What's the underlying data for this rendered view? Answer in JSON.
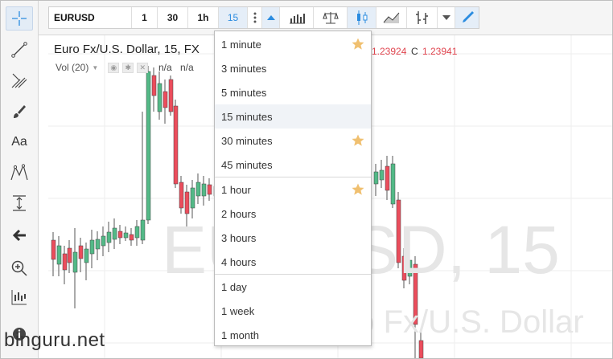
{
  "toolbar": {
    "symbol": "EURUSD",
    "intervals": [
      "1",
      "30",
      "1h",
      "15"
    ],
    "selected_interval": "15"
  },
  "chart": {
    "title": "Euro Fx/U.S. Dollar, 15, FX",
    "volume_label": "Vol (20)",
    "na_values": [
      "n/a",
      "n/a"
    ],
    "ohlc": {
      "h_value": "1.23924",
      "c_label": "C",
      "c_value": "1.23941"
    },
    "watermark_line1": "EURUSD, 15",
    "watermark_line2": "Euro Fx/U.S. Dollar",
    "colors": {
      "up": "#53b987",
      "down": "#eb4d5c",
      "accent": "#2b8ce0"
    }
  },
  "interval_menu": {
    "groups": [
      {
        "items": [
          {
            "label": "1 minute",
            "favorite": true
          },
          {
            "label": "3 minutes",
            "favorite": false
          },
          {
            "label": "5 minutes",
            "favorite": false
          },
          {
            "label": "15 minutes",
            "favorite": false,
            "highlighted": true
          },
          {
            "label": "30 minutes",
            "favorite": true
          },
          {
            "label": "45 minutes",
            "favorite": false
          }
        ]
      },
      {
        "items": [
          {
            "label": "1 hour",
            "favorite": true
          },
          {
            "label": "2 hours",
            "favorite": false
          },
          {
            "label": "3 hours",
            "favorite": false
          },
          {
            "label": "4 hours",
            "favorite": false
          }
        ]
      },
      {
        "items": [
          {
            "label": "1 day",
            "favorite": false
          },
          {
            "label": "1 week",
            "favorite": false
          },
          {
            "label": "1 month",
            "favorite": false
          }
        ]
      }
    ]
  },
  "footer": {
    "site": "binguru.net"
  },
  "left_tools": [
    "crosshair-icon",
    "trend-line-icon",
    "pitchfork-icon",
    "brush-icon",
    "text-icon",
    "pattern-icon",
    "measure-icon",
    "arrow-left-icon",
    "zoom-in-icon",
    "indicator-icon",
    "info-icon"
  ]
}
